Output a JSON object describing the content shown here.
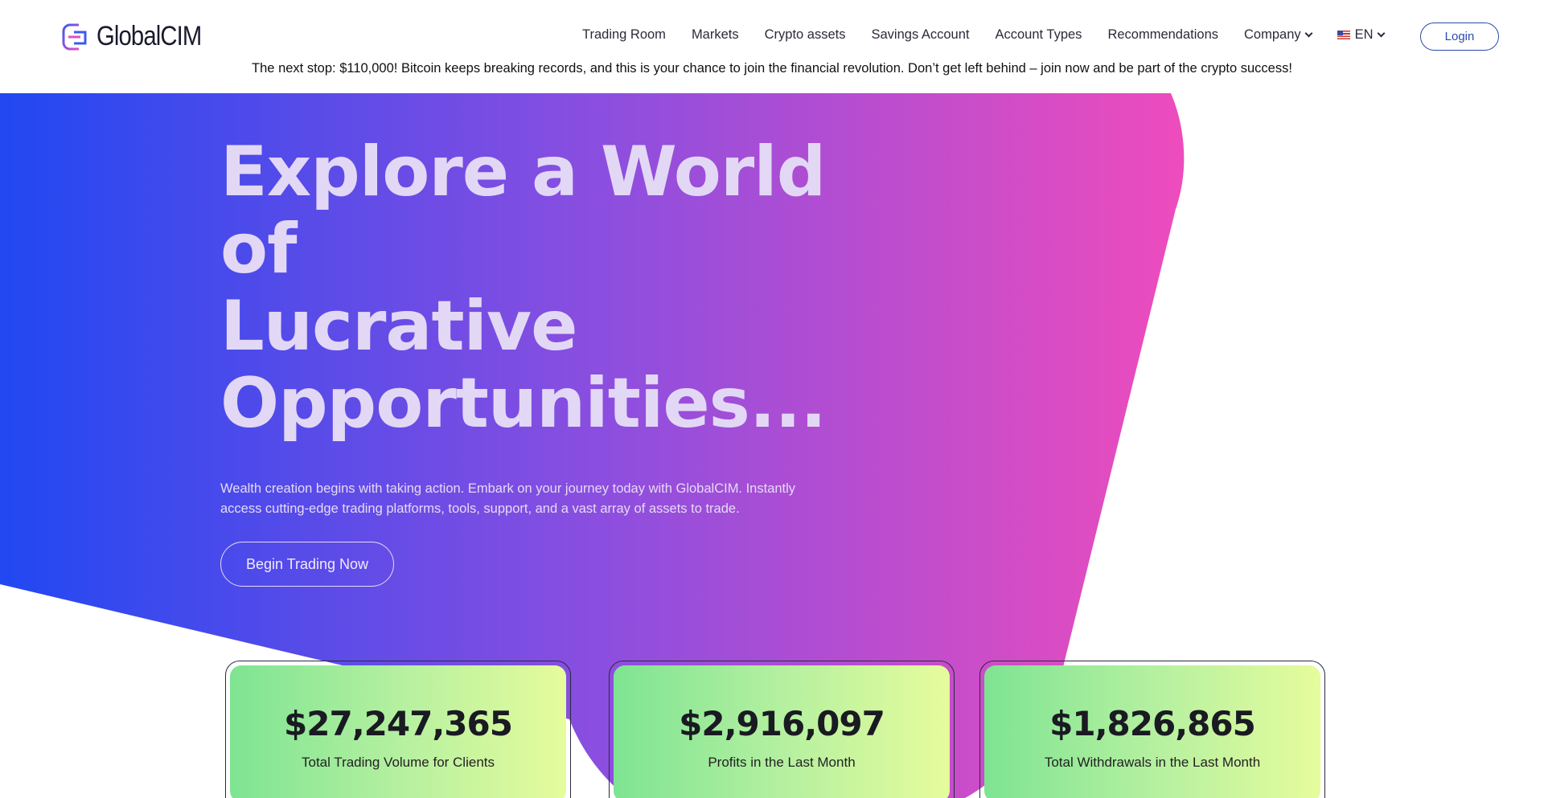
{
  "brand": {
    "name": "GlobalCIM"
  },
  "nav": {
    "items": [
      "Trading Room",
      "Markets",
      "Crypto assets",
      "Savings Account",
      "Account Types",
      "Recommendations"
    ],
    "company_label": "Company",
    "language_label": "EN",
    "login_label": "Login"
  },
  "ticker": {
    "text": "The next stop: $110,000! Bitcoin keeps breaking records, and this is your chance to join the financial revolution. Don’t get left behind – join now and be part of the crypto success!"
  },
  "hero": {
    "title_line1": "Explore a World of",
    "title_line2": "Lucrative",
    "title_line3": "Opportunities...",
    "subtitle": "Wealth creation begins with taking action. Embark on your journey today with GlobalCIM. Instantly access cutting-edge trading platforms, tools, support, and a vast array of assets to trade.",
    "cta_label": "Begin Trading Now"
  },
  "stats": [
    {
      "value": "$27,247,365",
      "label": "Total Trading Volume for Clients"
    },
    {
      "value": "$2,916,097",
      "label": "Profits in the Last Month"
    },
    {
      "value": "$1,826,865",
      "label": "Total Withdrawals in the Last Month"
    }
  ],
  "colors": {
    "gradient_start": "#2148f2",
    "gradient_mid": "#8a4ee0",
    "gradient_end": "#ee4cbc",
    "card_start": "#7ee492",
    "card_end": "#e6fc9c",
    "accent": "#2b4ca8"
  }
}
